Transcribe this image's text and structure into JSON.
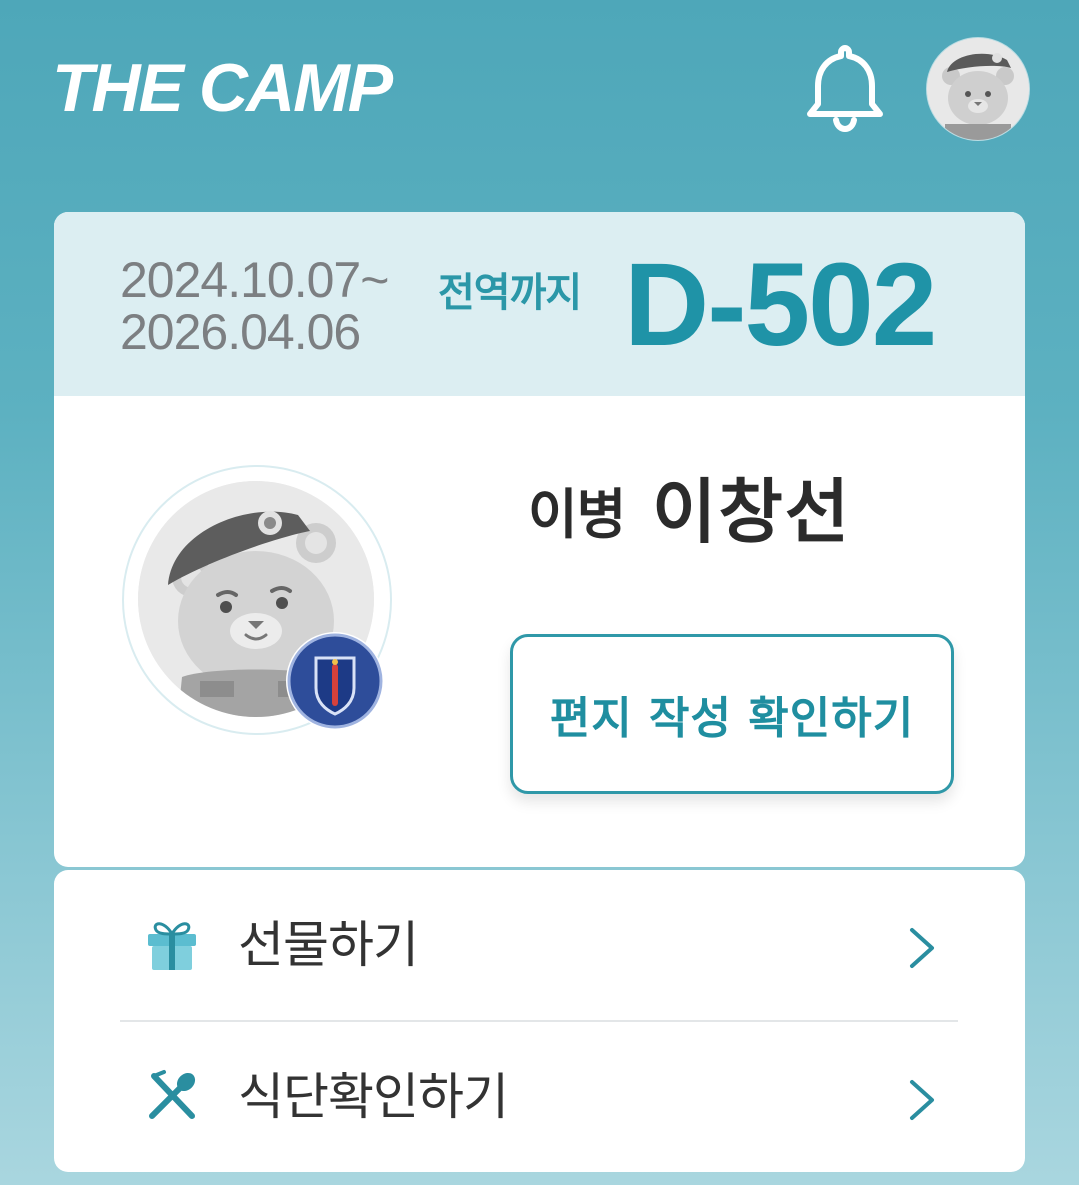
{
  "header": {
    "logo_text": "THE CAMP",
    "icons": {
      "notification": "bell-icon",
      "profile": "bear-avatar-icon"
    }
  },
  "service": {
    "start_date": "2024.10.07~",
    "end_date": "2026.04.06",
    "until_label": "전역까지",
    "dday": "D-502"
  },
  "soldier": {
    "rank": "이병",
    "name": "이창선",
    "letter_button_label": "편지 작성 확인하기"
  },
  "menu": {
    "items": [
      {
        "label": "선물하기",
        "icon": "gift-icon"
      },
      {
        "label": "식단확인하기",
        "icon": "utensils-icon"
      }
    ]
  },
  "colors": {
    "header_bg": "#4ea7b9",
    "accent": "#1f93a7",
    "band_bg": "#dceef2",
    "text_dark": "#2b2b2b",
    "date_gray": "#7c7f82"
  }
}
